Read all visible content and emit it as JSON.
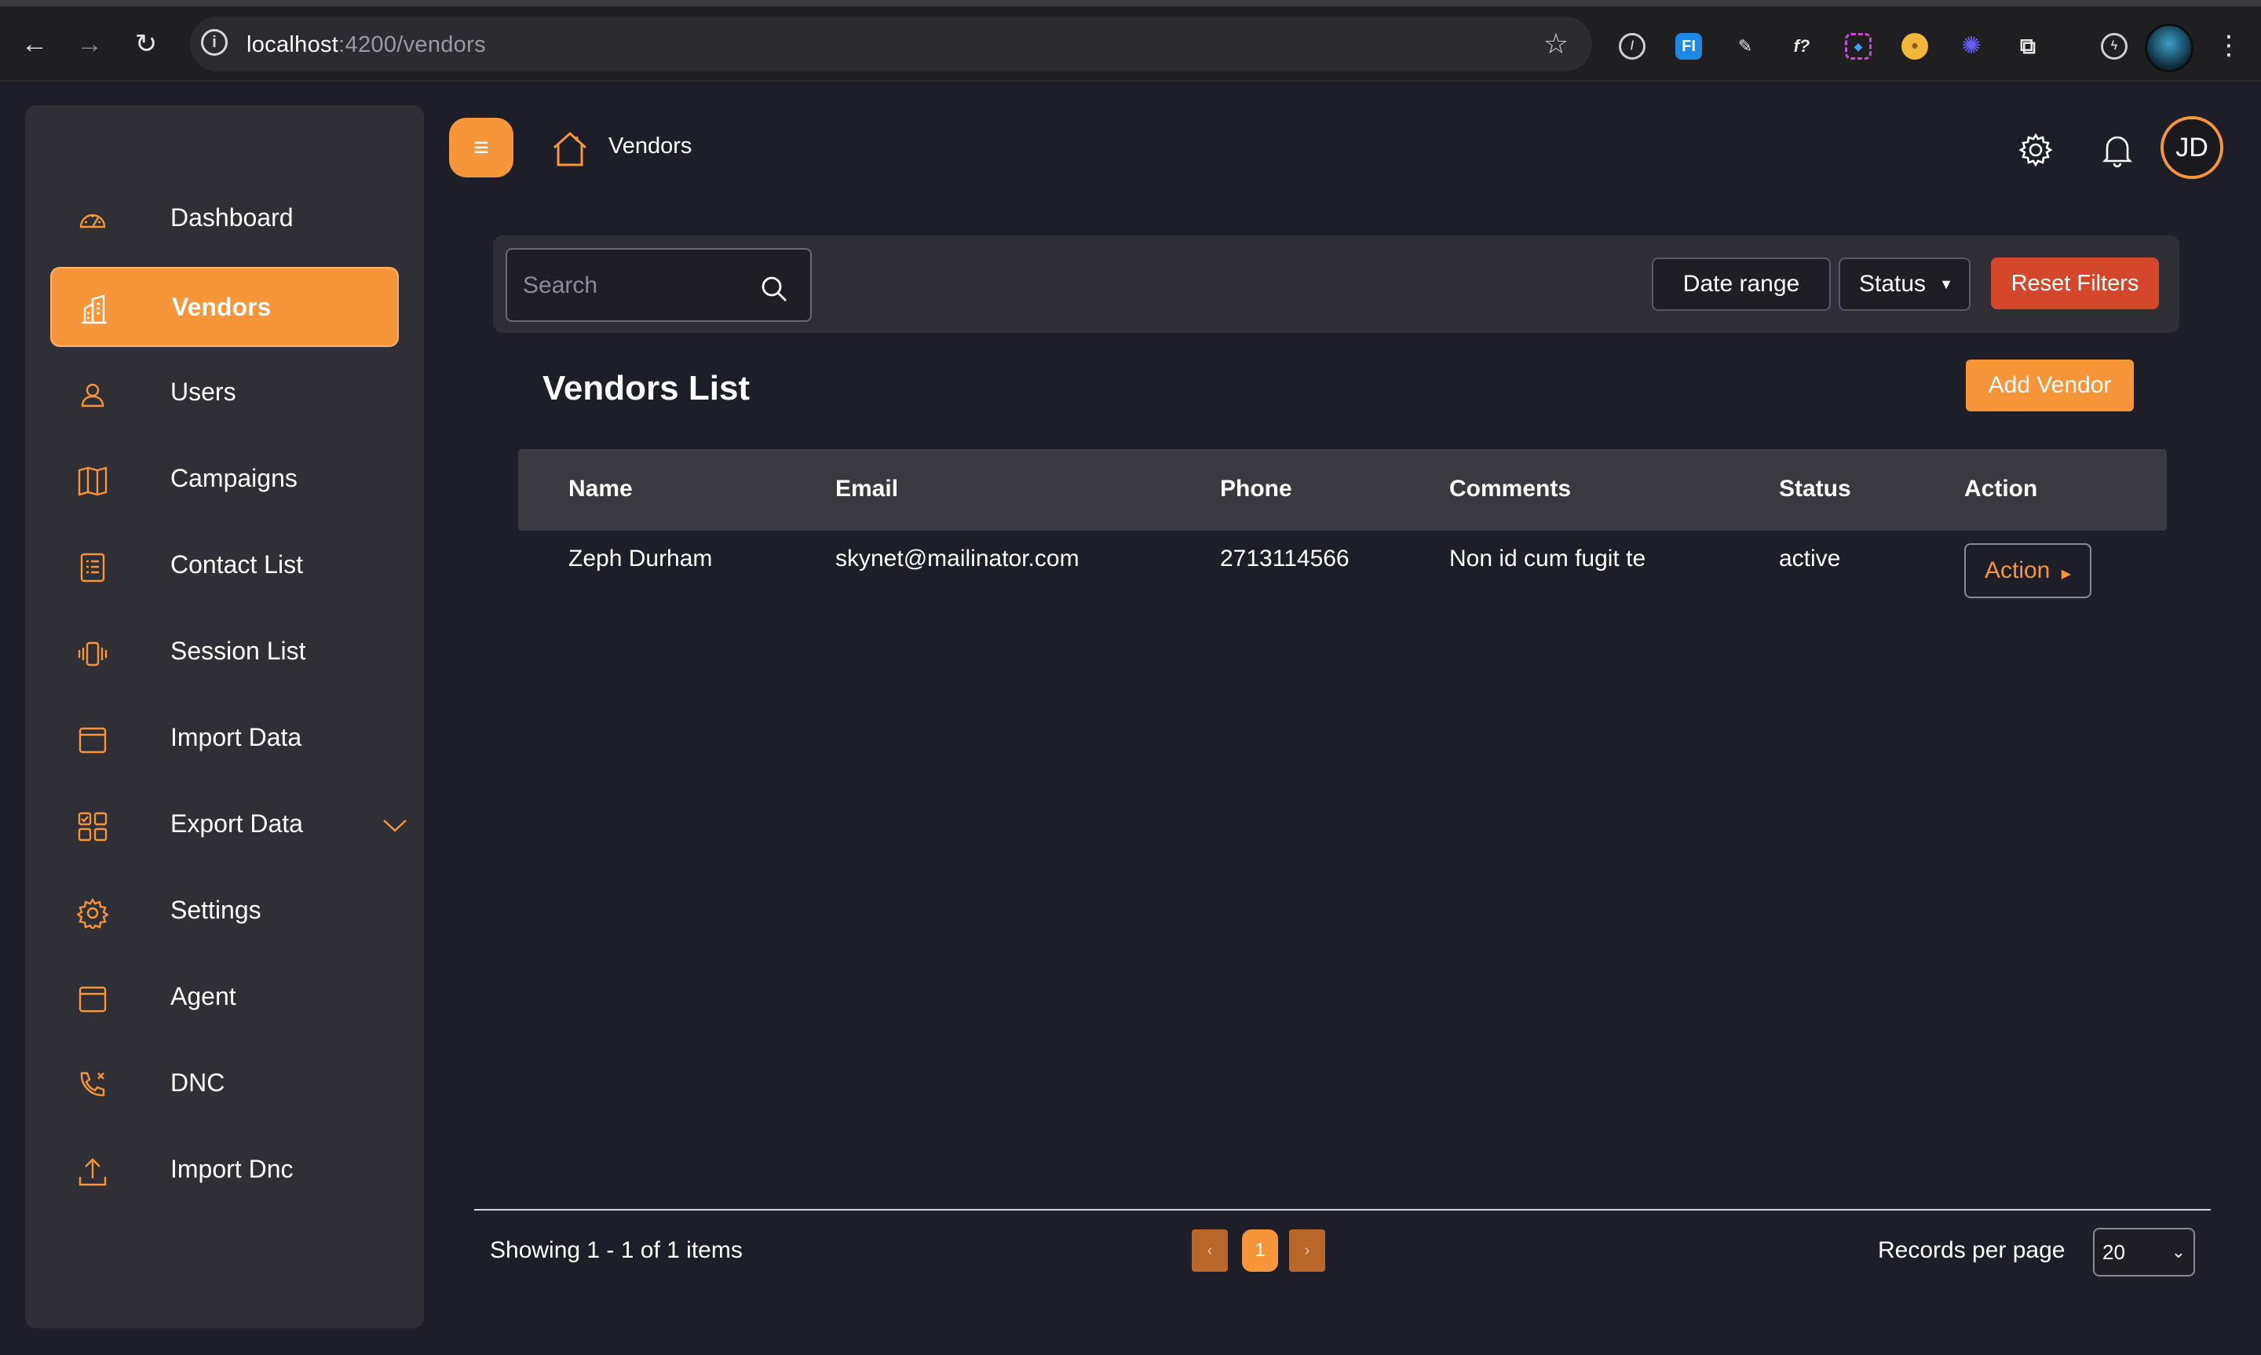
{
  "browser": {
    "url_host": "localhost",
    "url_path": ":4200/vendors",
    "profile_icon": "profile-avatar-icon"
  },
  "sidebar": {
    "items": [
      {
        "label": "Dashboard",
        "icon": "dashboard-icon"
      },
      {
        "label": "Vendors",
        "icon": "vendors-building-icon",
        "active": true
      },
      {
        "label": "Users",
        "icon": "user-icon"
      },
      {
        "label": "Campaigns",
        "icon": "map-icon"
      },
      {
        "label": "Contact List",
        "icon": "contact-list-icon"
      },
      {
        "label": "Session List",
        "icon": "phone-vibrate-icon"
      },
      {
        "label": "Import Data",
        "icon": "import-data-icon"
      },
      {
        "label": "Export Data",
        "icon": "export-data-icon",
        "expandable": true
      },
      {
        "label": "Settings",
        "icon": "gear-icon"
      },
      {
        "label": "Agent",
        "icon": "agent-icon"
      },
      {
        "label": "DNC",
        "icon": "phone-x-icon"
      },
      {
        "label": "Import Dnc",
        "icon": "upload-icon"
      }
    ]
  },
  "header": {
    "breadcrumb": "Vendors",
    "avatar_initials": "JD"
  },
  "filters": {
    "search_placeholder": "Search",
    "date_range_label": "Date range",
    "status_label": "Status",
    "reset_label": "Reset Filters"
  },
  "list": {
    "title": "Vendors List",
    "add_label": "Add Vendor",
    "columns": [
      "Name",
      "Email",
      "Phone",
      "Comments",
      "Status",
      "Action"
    ],
    "rows": [
      {
        "name": "Zeph Durham",
        "email": "skynet@mailinator.com",
        "phone": "2713114566",
        "comments": "Non id cum fugit te",
        "status": "active",
        "action_label": "Action"
      }
    ]
  },
  "pagination": {
    "showing": "Showing 1 - 1 of 1 items",
    "current_page": "1",
    "prev_symbol": "‹",
    "next_symbol": "›",
    "records_label": "Records per page",
    "records_value": "20"
  },
  "colors": {
    "accent": "#f6953a",
    "danger": "#d5472b",
    "background": "#1e1e28",
    "sidebar": "#302f36"
  }
}
